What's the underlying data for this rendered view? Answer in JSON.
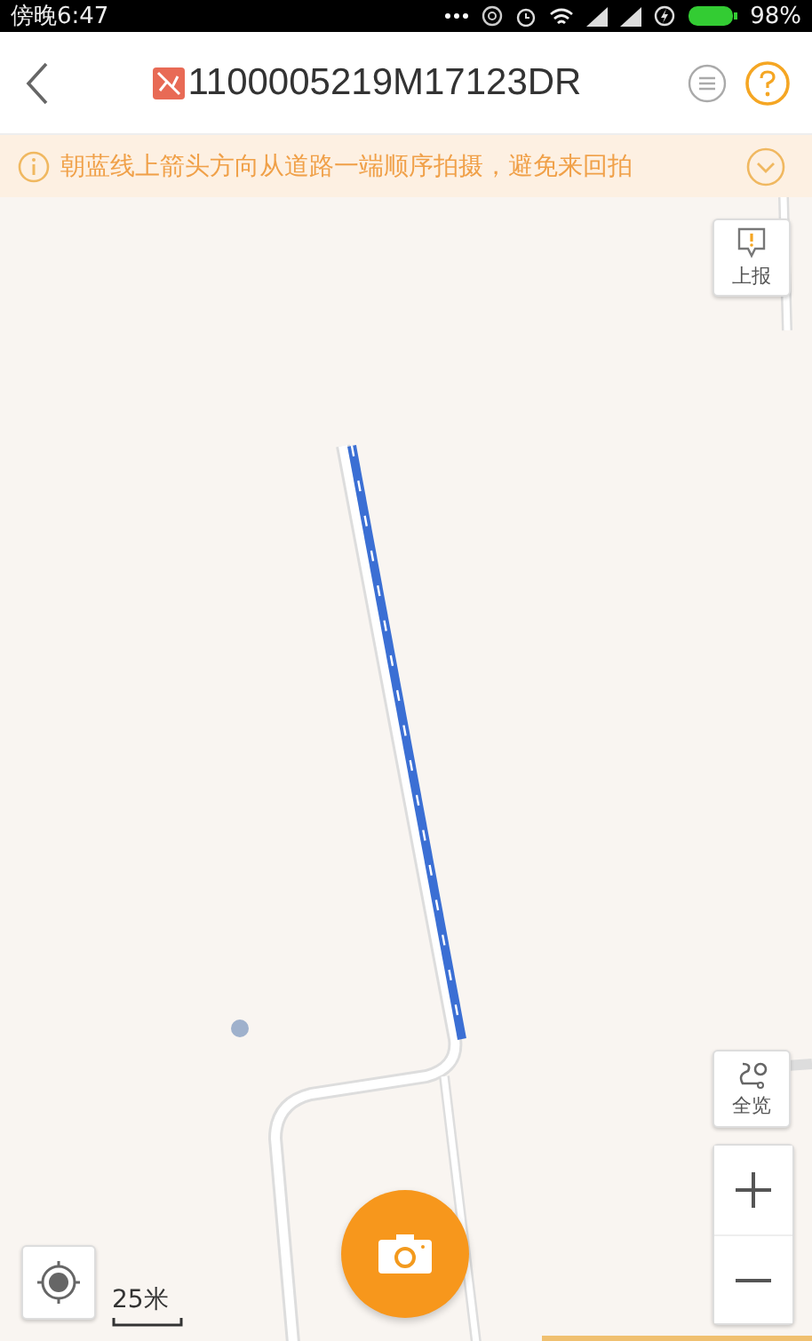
{
  "status_bar": {
    "time": "傍晚6:47",
    "battery": "98%"
  },
  "header": {
    "title": "1100005219M17123DR"
  },
  "notice": {
    "text": "朝蓝线上箭头方向从道路一端顺序拍摄，避免来回拍"
  },
  "map": {
    "report_button": "上报",
    "overview_button": "全览",
    "scale": "25米"
  }
}
